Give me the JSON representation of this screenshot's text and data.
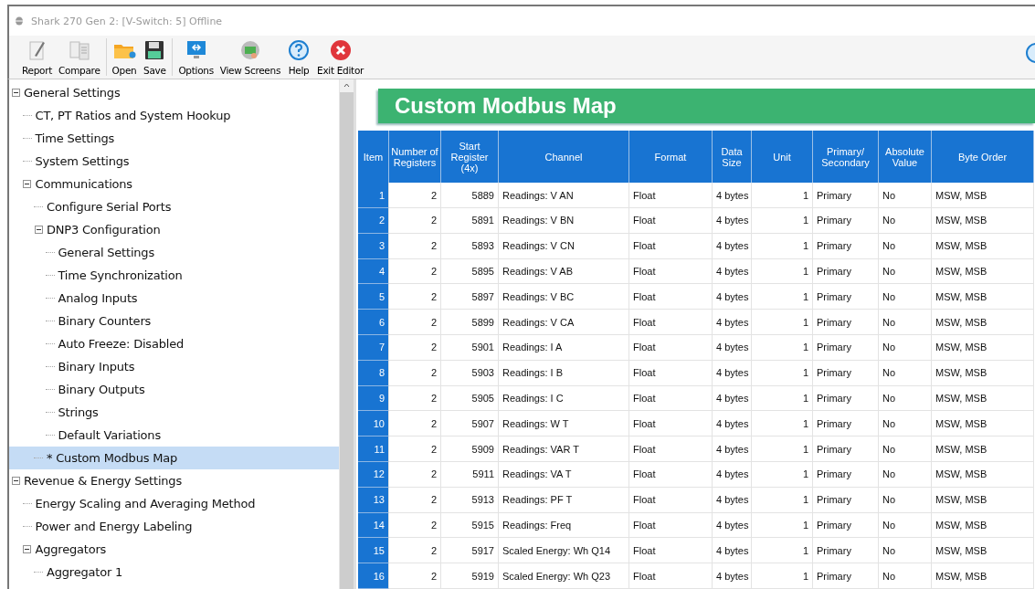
{
  "window": {
    "title": "Shark 270 Gen 2: [V-Switch: 5] Offline"
  },
  "toolbar": {
    "groups": [
      [
        {
          "label": "Report",
          "kind": "report"
        },
        {
          "label": "Compare",
          "kind": "compare"
        }
      ],
      [
        {
          "label": "Open",
          "kind": "open"
        },
        {
          "label": "Save",
          "kind": "save"
        }
      ],
      [
        {
          "label": "Options",
          "kind": "options"
        },
        {
          "label": "View Screens",
          "kind": "screens"
        },
        {
          "label": "Help",
          "kind": "help"
        },
        {
          "label": "Exit Editor",
          "kind": "exit"
        }
      ]
    ]
  },
  "tree": [
    {
      "label": "General Settings",
      "expanded": true,
      "selected": false,
      "children": [
        {
          "label": "CT, PT Ratios and System Hookup",
          "selected": false
        },
        {
          "label": "Time Settings",
          "selected": false
        },
        {
          "label": "System Settings",
          "selected": false
        },
        {
          "label": "Communications",
          "expanded": true,
          "selected": false,
          "children": [
            {
              "label": "Configure Serial Ports",
              "selected": false
            },
            {
              "label": "DNP3 Configuration",
              "expanded": true,
              "selected": false,
              "children": [
                {
                  "label": "General Settings",
                  "selected": false
                },
                {
                  "label": "Time Synchronization",
                  "selected": false
                },
                {
                  "label": "Analog Inputs",
                  "selected": false
                },
                {
                  "label": "Binary Counters",
                  "selected": false
                },
                {
                  "label": "Auto Freeze: Disabled",
                  "selected": false
                },
                {
                  "label": "Binary Inputs",
                  "selected": false
                },
                {
                  "label": "Binary Outputs",
                  "selected": false
                },
                {
                  "label": "Strings",
                  "selected": false
                },
                {
                  "label": "Default Variations",
                  "selected": false
                }
              ]
            },
            {
              "label": "* Custom Modbus Map",
              "selected": true
            }
          ]
        }
      ]
    },
    {
      "label": "Revenue & Energy Settings",
      "expanded": true,
      "selected": false,
      "children": [
        {
          "label": "Energy Scaling and Averaging Method",
          "selected": false
        },
        {
          "label": "Power and Energy Labeling",
          "selected": false
        },
        {
          "label": "Aggregators",
          "expanded": true,
          "selected": false,
          "children": [
            {
              "label": "Aggregator 1",
              "selected": false
            }
          ]
        }
      ]
    }
  ],
  "panel": {
    "title": "Custom Modbus Map"
  },
  "table": {
    "columns": [
      "Item",
      "Number of Registers",
      "Start Register (4x)",
      "Channel",
      "Format",
      "Data Size",
      "Unit",
      "Primary/Secondary",
      "Absolute Value",
      "Byte Order"
    ],
    "rows": [
      [
        "1",
        "2",
        "5889",
        "Readings: V AN",
        "Float",
        "4 bytes",
        "1",
        "Primary",
        "No",
        "MSW, MSB"
      ],
      [
        "2",
        "2",
        "5891",
        "Readings: V BN",
        "Float",
        "4 bytes",
        "1",
        "Primary",
        "No",
        "MSW, MSB"
      ],
      [
        "3",
        "2",
        "5893",
        "Readings: V CN",
        "Float",
        "4 bytes",
        "1",
        "Primary",
        "No",
        "MSW, MSB"
      ],
      [
        "4",
        "2",
        "5895",
        "Readings: V AB",
        "Float",
        "4 bytes",
        "1",
        "Primary",
        "No",
        "MSW, MSB"
      ],
      [
        "5",
        "2",
        "5897",
        "Readings: V BC",
        "Float",
        "4 bytes",
        "1",
        "Primary",
        "No",
        "MSW, MSB"
      ],
      [
        "6",
        "2",
        "5899",
        "Readings: V CA",
        "Float",
        "4 bytes",
        "1",
        "Primary",
        "No",
        "MSW, MSB"
      ],
      [
        "7",
        "2",
        "5901",
        "Readings: I A",
        "Float",
        "4 bytes",
        "1",
        "Primary",
        "No",
        "MSW, MSB"
      ],
      [
        "8",
        "2",
        "5903",
        "Readings: I B",
        "Float",
        "4 bytes",
        "1",
        "Primary",
        "No",
        "MSW, MSB"
      ],
      [
        "9",
        "2",
        "5905",
        "Readings: I C",
        "Float",
        "4 bytes",
        "1",
        "Primary",
        "No",
        "MSW, MSB"
      ],
      [
        "10",
        "2",
        "5907",
        "Readings: W T",
        "Float",
        "4 bytes",
        "1",
        "Primary",
        "No",
        "MSW, MSB"
      ],
      [
        "11",
        "2",
        "5909",
        "Readings: VAR T",
        "Float",
        "4 bytes",
        "1",
        "Primary",
        "No",
        "MSW, MSB"
      ],
      [
        "12",
        "2",
        "5911",
        "Readings: VA T",
        "Float",
        "4 bytes",
        "1",
        "Primary",
        "No",
        "MSW, MSB"
      ],
      [
        "13",
        "2",
        "5913",
        "Readings: PF T",
        "Float",
        "4 bytes",
        "1",
        "Primary",
        "No",
        "MSW, MSB"
      ],
      [
        "14",
        "2",
        "5915",
        "Readings: Freq",
        "Float",
        "4 bytes",
        "1",
        "Primary",
        "No",
        "MSW, MSB"
      ],
      [
        "15",
        "2",
        "5917",
        "Scaled Energy: Wh Q14",
        "Float",
        "4 bytes",
        "1",
        "Primary",
        "No",
        "MSW, MSB"
      ],
      [
        "16",
        "2",
        "5919",
        "Scaled Energy: Wh Q23",
        "Float",
        "4 bytes",
        "1",
        "Primary",
        "No",
        "MSW, MSB"
      ]
    ]
  }
}
